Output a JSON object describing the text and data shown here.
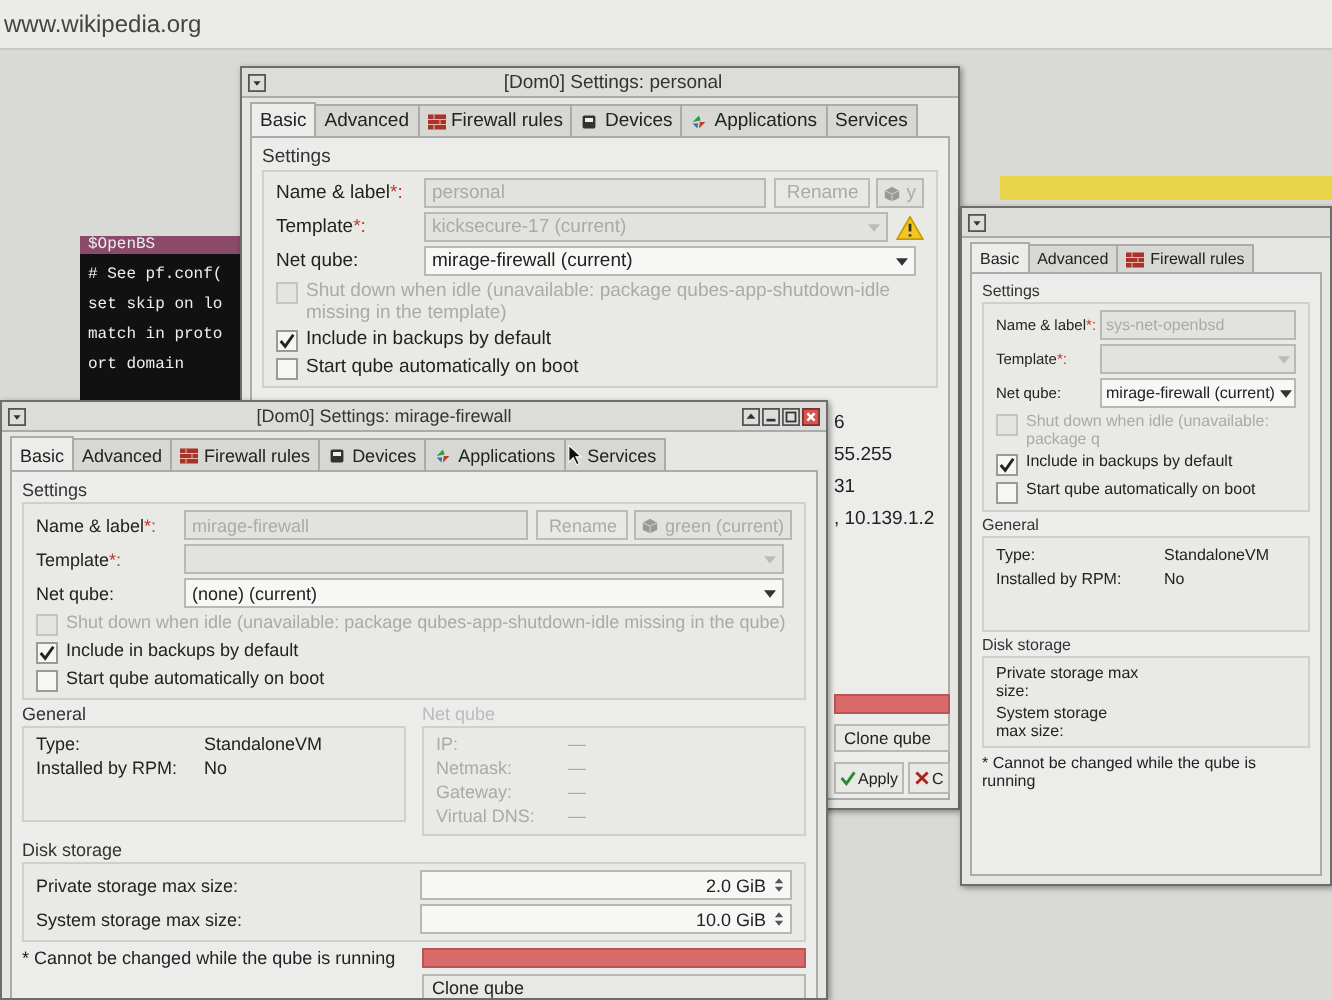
{
  "browser": {
    "url": "www.wikipedia.org"
  },
  "terminal": {
    "lines": [
      "$OpenBS",
      "# See pf.conf(",
      "set skip on lo",
      "match in proto",
      "ort domain"
    ]
  },
  "windows": [
    {
      "title": "[Dom0] Settings: personal",
      "window_buttons": false,
      "pointer": false,
      "tabs": [
        {
          "label": "Basic",
          "kind": "plain",
          "selected": true
        },
        {
          "label": "Advanced",
          "kind": "plain",
          "selected": false
        },
        {
          "label": "Firewall rules",
          "kind": "firewall",
          "selected": false
        },
        {
          "label": "Devices",
          "kind": "devices",
          "selected": false
        },
        {
          "label": "Applications",
          "kind": "applications",
          "selected": false
        },
        {
          "label": "Services",
          "kind": "plain",
          "selected": false
        }
      ],
      "section": "Settings",
      "fields": [
        {
          "kind": "name",
          "label": "Name & label",
          "mark": "*:",
          "value": "personal",
          "disabled": true,
          "button": "Rename",
          "color_select": "y"
        },
        {
          "kind": "select",
          "label": "Template",
          "mark": "*:",
          "value": "kicksecure-17 (current)",
          "disabled": true,
          "warning": true
        },
        {
          "kind": "select",
          "label": "Net qube:",
          "value": "mirage-firewall (current)",
          "disabled": false,
          "warning": false
        }
      ],
      "checks": [
        {
          "label": "Shut down when idle (unavailable: package qubes-app-shutdown-idle missing in the template)",
          "checked": false,
          "disabled": true
        },
        {
          "label": "Include in backups by default",
          "checked": true,
          "disabled": false
        },
        {
          "label": "Start qube automatically on boot",
          "checked": false,
          "disabled": false
        }
      ],
      "remnant": {
        "net_values": [
          "6",
          "55.255",
          "31",
          ", 10.139.1.2"
        ],
        "actions": [
          {
            "kind": "danger"
          },
          {
            "kind": "plain",
            "label": "Clone qube"
          },
          {
            "kind": "apply",
            "label": "Apply"
          },
          {
            "kind": "cancel",
            "label": "C"
          }
        ]
      }
    },
    {
      "window_buttons": false,
      "pointer": false,
      "tabs": [
        {
          "label": "Basic",
          "kind": "plain",
          "selected": true
        },
        {
          "label": "Advanced",
          "kind": "plain",
          "selected": false
        },
        {
          "label": "Firewall rules",
          "kind": "firewall",
          "selected": false
        }
      ],
      "section": "Settings",
      "fields": [
        {
          "kind": "name",
          "label": "Name & label",
          "mark": "*:",
          "value": "sys-net-openbsd",
          "disabled": true
        },
        {
          "kind": "select",
          "label": "Template",
          "mark": "*:",
          "disabled": true
        },
        {
          "kind": "select",
          "label": "Net qube:",
          "value": "mirage-firewall (current)",
          "disabled": false
        }
      ],
      "checks": [
        {
          "label": "Shut down when idle (unavailable: package q",
          "checked": false,
          "disabled": true
        },
        {
          "label": "Include in backups by default",
          "checked": true,
          "disabled": false
        },
        {
          "label": "Start qube automatically on boot",
          "checked": false,
          "disabled": false
        }
      ],
      "general": {
        "title": "General",
        "rows": [
          {
            "label": "Type:",
            "value": "StandaloneVM"
          },
          {
            "label": "Installed by RPM:",
            "value": "No"
          }
        ]
      },
      "disk": {
        "title": "Disk storage",
        "rows": [
          {
            "label": "Private storage max size:"
          },
          {
            "label": "System storage max size:"
          }
        ],
        "note": "* Cannot be changed while the qube is running"
      }
    },
    {
      "title": "[Dom0] Settings: mirage-firewall",
      "window_buttons": true,
      "pointer": true,
      "tabs": [
        {
          "label": "Basic",
          "kind": "plain",
          "selected": true
        },
        {
          "label": "Advanced",
          "kind": "plain",
          "selected": false
        },
        {
          "label": "Firewall rules",
          "kind": "firewall",
          "selected": false
        },
        {
          "label": "Devices",
          "kind": "devices",
          "selected": false
        },
        {
          "label": "Applications",
          "kind": "applications",
          "selected": false
        },
        {
          "label": "Services",
          "kind": "plain",
          "selected": false
        }
      ],
      "section": "Settings",
      "fields": [
        {
          "kind": "name",
          "label": "Name & label",
          "mark": "*:",
          "value": "mirage-firewall",
          "disabled": true,
          "button": "Rename",
          "color_select": "green (current)"
        },
        {
          "kind": "select",
          "label": "Template",
          "mark": "*:",
          "disabled": true,
          "warning": false
        },
        {
          "kind": "select",
          "label": "Net qube:",
          "value": "(none) (current)",
          "disabled": false,
          "warning": false
        }
      ],
      "checks": [
        {
          "label": "Shut down when idle (unavailable: package qubes-app-shutdown-idle missing in the qube)",
          "checked": false,
          "disabled": true
        },
        {
          "label": "Include in backups by default",
          "checked": true,
          "disabled": false
        },
        {
          "label": "Start qube automatically on boot",
          "checked": false,
          "disabled": false
        }
      ],
      "general": {
        "title": "General",
        "rows": [
          {
            "label": "Type:",
            "value": "StandaloneVM"
          },
          {
            "label": "Installed by RPM:",
            "value": "No"
          }
        ]
      },
      "net": {
        "title": "Net qube",
        "disabled": true,
        "rows": [
          {
            "label": "IP:",
            "value": "—"
          },
          {
            "label": "Netmask:",
            "value": "—"
          },
          {
            "label": "Gateway:",
            "value": "—"
          },
          {
            "label": "Virtual DNS:",
            "value": "—"
          }
        ]
      },
      "disk": {
        "title": "Disk storage",
        "rows": [
          {
            "label": "Private storage max size:",
            "value": "2.0 GiB"
          },
          {
            "label": "System storage max size:",
            "value": "10.0 GiB"
          }
        ],
        "note": "* Cannot be changed while the qube is running",
        "actions": [
          {
            "kind": "danger"
          },
          {
            "kind": "plain",
            "label": "Clone qube"
          }
        ]
      }
    }
  ]
}
